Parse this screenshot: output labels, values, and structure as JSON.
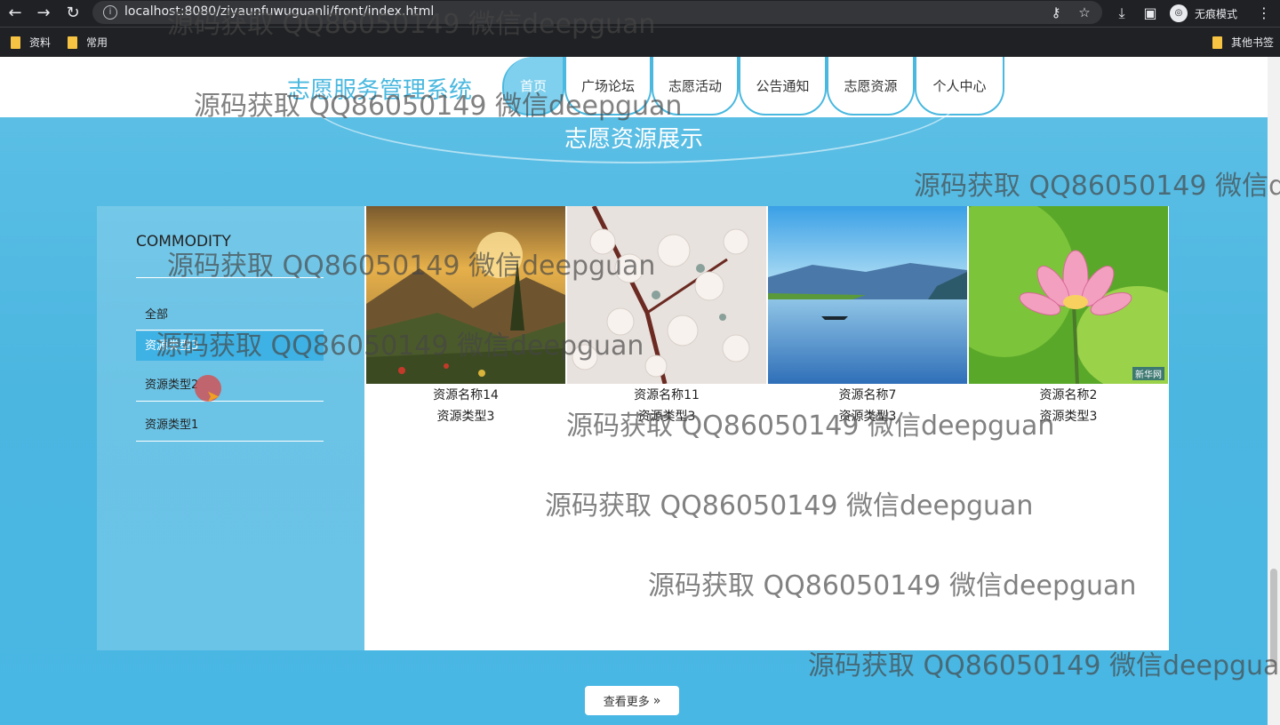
{
  "browser": {
    "url": "localhost:8080/ziyaunfuwuguanli/front/index.html",
    "incognito_label": "无痕模式",
    "bookmarks": [
      "资料",
      "常用"
    ],
    "other_bookmarks": "其他书签"
  },
  "site": {
    "brand": "志愿服务管理系统",
    "nav": [
      "首页",
      "广场论坛",
      "志愿活动",
      "公告通知",
      "志愿资源",
      "个人中心"
    ],
    "active_nav": "首页",
    "section_title": "志愿资源展示",
    "colors": {
      "accent": "#4ab8df",
      "background": "#4bb8e2",
      "active_item": "#3eb2e4"
    }
  },
  "sidebar": {
    "title": "COMMODITY",
    "items": [
      "全部",
      "资源类型3",
      "资源类型2",
      "资源类型1"
    ],
    "active_index": 1
  },
  "cards": [
    {
      "name": "资源名称14",
      "type": "资源类型3",
      "image": "mountain-sunset"
    },
    {
      "name": "资源名称11",
      "type": "资源类型3",
      "image": "cherry-blossom"
    },
    {
      "name": "资源名称7",
      "type": "资源类型3",
      "image": "lake-boat"
    },
    {
      "name": "资源名称2",
      "type": "资源类型3",
      "image": "lotus-flower",
      "image_badge": "新华网"
    }
  ],
  "more_button": {
    "label": "查看更多",
    "icon": "double-chevron-right-icon"
  },
  "watermark": "源码获取 QQ86050149 微信deepguan"
}
